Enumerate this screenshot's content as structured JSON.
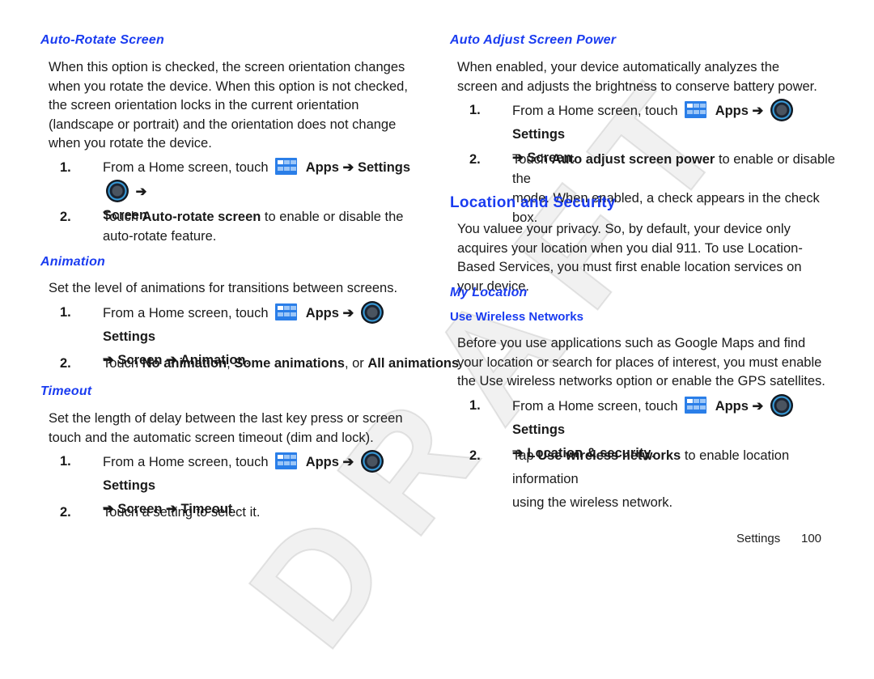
{
  "left": {
    "auto_rotate": {
      "title": "Auto-Rotate Screen",
      "para": "When this option is checked, the screen orientation changes when you rotate the device. When this option is not checked, the screen orientation locks in the current orientation (landscape or portrait) and the orientation does not change when you rotate the device.",
      "step1": {
        "num": "1.",
        "pre": "From a Home screen, touch",
        "apps": "Apps",
        "arrow": "➔",
        "settings": "Settings",
        "arrow2": "➔",
        "target": "Screen",
        "end": "."
      },
      "step2": {
        "num": "2.",
        "pre": "Touch",
        "bold": "Auto-rotate screen",
        "post": "to enable or disable the auto-rotate feature."
      }
    },
    "animation": {
      "title": "Animation",
      "para": "Set the level of animations for transitions between screens.",
      "step1": {
        "num": "1.",
        "pre": "From a Home screen, touch",
        "apps": "Apps ➔",
        "settings": "Settings",
        "path": "➔ Screen ➔ Animation",
        "end": "."
      },
      "step2": {
        "num": "2.",
        "pre": "Touch",
        "opt1": "No animation",
        "sep1": ",",
        "opt2": "Some animations",
        "sep2": ", or",
        "opt3": "All animations",
        "end": "."
      }
    },
    "timeout": {
      "title": "Timeout",
      "para": "Set the length of delay between the last key press or screen touch and the automatic screen timeout (dim and lock).",
      "step1": {
        "num": "1.",
        "pre": "From a Home screen, touch",
        "apps": "Apps ➔",
        "settings": "Settings",
        "path": "➔ Screen ➔ Timeout",
        "end": "."
      },
      "step2": {
        "num": "2.",
        "text": "Touch a setting to select it."
      }
    }
  },
  "right": {
    "auto_adjust": {
      "title": "Auto Adjust Screen Power",
      "para": "When enabled, your device automatically analyzes the screen and adjusts the brightness to conserve battery power.",
      "step1": {
        "num": "1.",
        "pre": "From a Home screen, touch",
        "apps": "Apps ➔",
        "settings": "Settings",
        "path": "➔ Screen",
        "end": "."
      },
      "step2": {
        "num": "2.",
        "pre": "Touch",
        "bold": "Auto adjust screen power",
        "post": "to enable or disable the",
        "line2": "mode. When enabled, a check appears in the check box."
      }
    },
    "location_security": {
      "title": "Location and Security",
      "para": "You valuee your privacy. So, by default, your device only acquires your location when you dial 911. To use Location-Based Services, you must first enable location services on your device."
    },
    "my_location": {
      "title": "My Location",
      "subtitle": "Use Wireless Networks",
      "para": "Before you use applications such as Google Maps and find your location or search for places of interest, you must enable the Use wireless networks option or enable the GPS satellites.",
      "step1": {
        "num": "1.",
        "pre": "From a Home screen, touch",
        "apps": "Apps ➔",
        "settings": "Settings",
        "path": "➔ Location & security",
        "end": "."
      },
      "step2": {
        "num": "2.",
        "pre": "Tap",
        "bold": "Use wireless networks",
        "post": "to enable location information",
        "line2": "using the wireless network."
      }
    }
  },
  "footer": {
    "section": "Settings",
    "page": "100"
  },
  "watermark": "DRAFT",
  "icons": {
    "apps": "apps-grid-icon",
    "settings": "settings-knob-icon"
  },
  "colors": {
    "heading": "#1a3cf0",
    "text": "#1a1a1a",
    "apps_icon": "#2a7ee8"
  }
}
